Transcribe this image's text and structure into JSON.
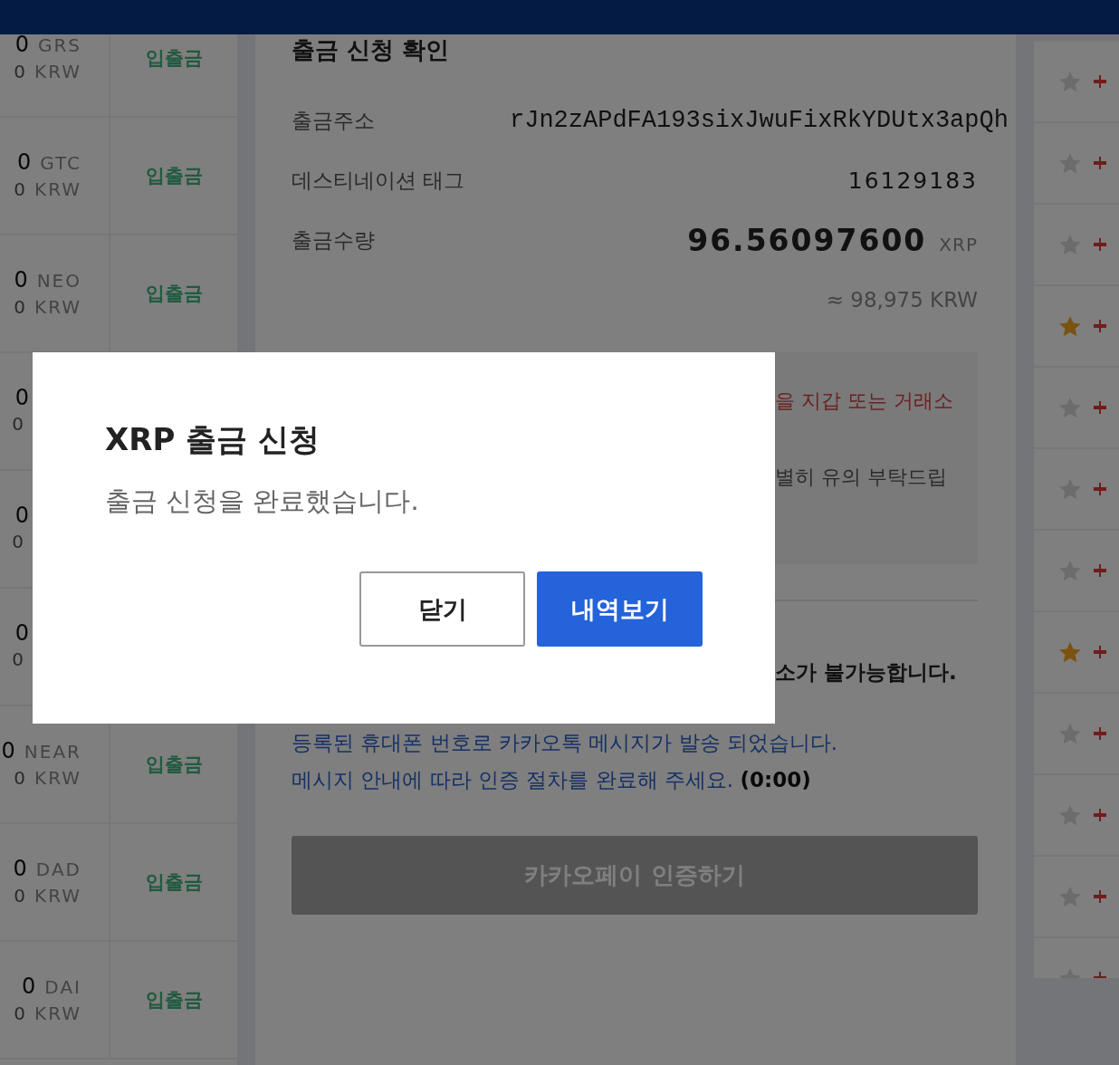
{
  "balances": [
    {
      "amount": "0",
      "symbol": "GRS",
      "krw_amount": "0",
      "krw_unit": "KRW",
      "action": "입출금"
    },
    {
      "amount": "0",
      "symbol": "GTC",
      "krw_amount": "0",
      "krw_unit": "KRW",
      "action": "입출금"
    },
    {
      "amount": "0",
      "symbol": "NEO",
      "krw_amount": "0",
      "krw_unit": "KRW",
      "action": "입출금"
    },
    {
      "amount": "0",
      "krw_amount": "0"
    },
    {
      "amount": "0",
      "krw_amount": "0"
    },
    {
      "amount": "0",
      "krw_amount": "0"
    },
    {
      "amount": "0",
      "symbol": "NEAR",
      "krw_amount": "0",
      "krw_unit": "KRW",
      "action": "입출금"
    },
    {
      "amount": "0",
      "symbol": "DAD",
      "krw_amount": "0",
      "krw_unit": "KRW",
      "action": "입출금"
    },
    {
      "amount": "0",
      "symbol": "DAI",
      "krw_amount": "0",
      "krw_unit": "KRW",
      "action": "입출금"
    }
  ],
  "confirm": {
    "title": "출금 신청 확인",
    "rows": [
      {
        "kind": "address",
        "label": "출금주소",
        "value": "rJn2zAPdFA193sixJwuFixRkYDUtx3apQh"
      },
      {
        "kind": "plain",
        "label": "데스티네이션 태그",
        "value": "16129183"
      },
      {
        "kind": "amount",
        "label": "출금수량",
        "value": "96.56097600",
        "unit": "XRP"
      }
    ],
    "krw_estimate": "≈ 98,975 KRW",
    "notice_lines": [
      {
        "kind": "warning",
        "text": "을 지갑 또는 거래소"
      },
      {
        "kind": "info",
        "text": "별히 유의 부탁드립"
      }
    ],
    "cancel_note": "소가 불가능합니다.",
    "kakao_lines": [
      "등록된 휴대폰 번호로 카카오톡 메시지가 발송 되었습니다.",
      "메시지 안내에 따라 인증 절차를 완료해 주세요. **(0:00)**"
    ],
    "kakao_button": {
      "label": "카카오페이 인증하기",
      "disabled": true
    }
  },
  "market_list": [
    {
      "favorite": false
    },
    {
      "favorite": false
    },
    {
      "favorite": false
    },
    {
      "favorite": true
    },
    {
      "favorite": false
    },
    {
      "favorite": false
    },
    {
      "favorite": false
    },
    {
      "favorite": true
    },
    {
      "favorite": false
    },
    {
      "favorite": false
    },
    {
      "favorite": false
    },
    {
      "favorite": false
    }
  ],
  "dialog": {
    "title": "XRP 출금 신청",
    "message": "출금 신청을 완료했습니다.",
    "buttons": [
      {
        "kind": "secondary",
        "label": "닫기"
      },
      {
        "kind": "primary",
        "label": "내역보기"
      }
    ]
  }
}
